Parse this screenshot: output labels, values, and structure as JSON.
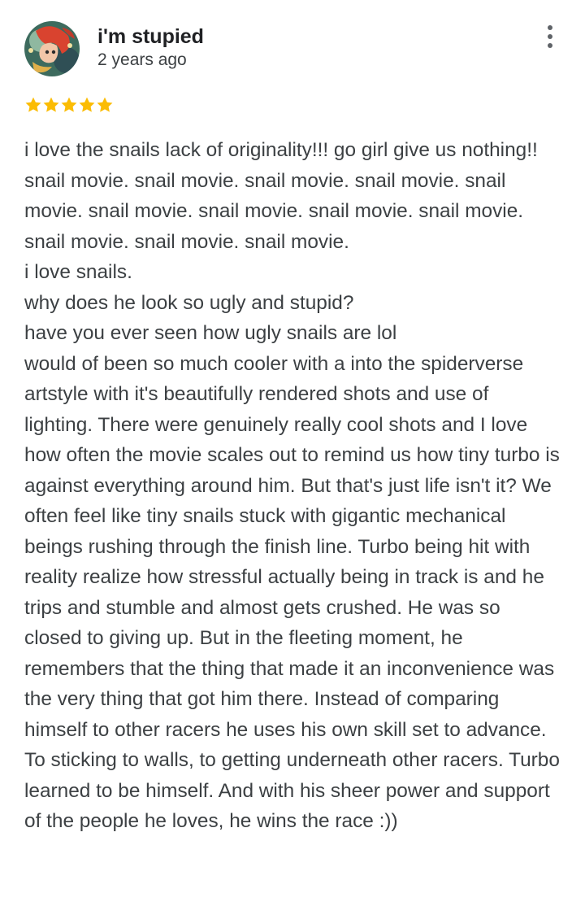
{
  "review": {
    "author": "i'm stupied",
    "date": "2 years ago",
    "rating": 5,
    "rating_max": 5,
    "star_color": "#fbbc04",
    "more_icon": "more-vert-icon",
    "text": "i love the snails lack of originality!!! go girl give us nothing!!\nsnail movie. snail movie. snail movie. snail movie. snail movie. snail movie. snail movie. snail movie. snail movie. snail movie. snail movie. snail movie.\ni love snails.\nwhy does he look so ugly and stupid?\nhave you ever seen how ugly snails are lol\nwould of been so much cooler with a into the spiderverse artstyle with it's beautifully rendered shots and use of lighting. There were genuinely really cool shots and I love how often the movie scales out to remind us how tiny turbo is against everything around him. But that's just life isn't it? We often feel like tiny snails stuck with gigantic mechanical beings rushing through the finish line. Turbo being hit with reality realize how stressful actually being in track is and he trips and stumble and almost gets crushed. He was so closed to giving up. But in the fleeting moment, he remembers that the thing that made it an inconvenience was the very thing that got him there. Instead of comparing himself to other racers he uses his own skill set to advance. To sticking to walls, to getting underneath other racers. Turbo learned to be himself. And with his sheer power and support of the people he loves, he wins the race :))"
  }
}
